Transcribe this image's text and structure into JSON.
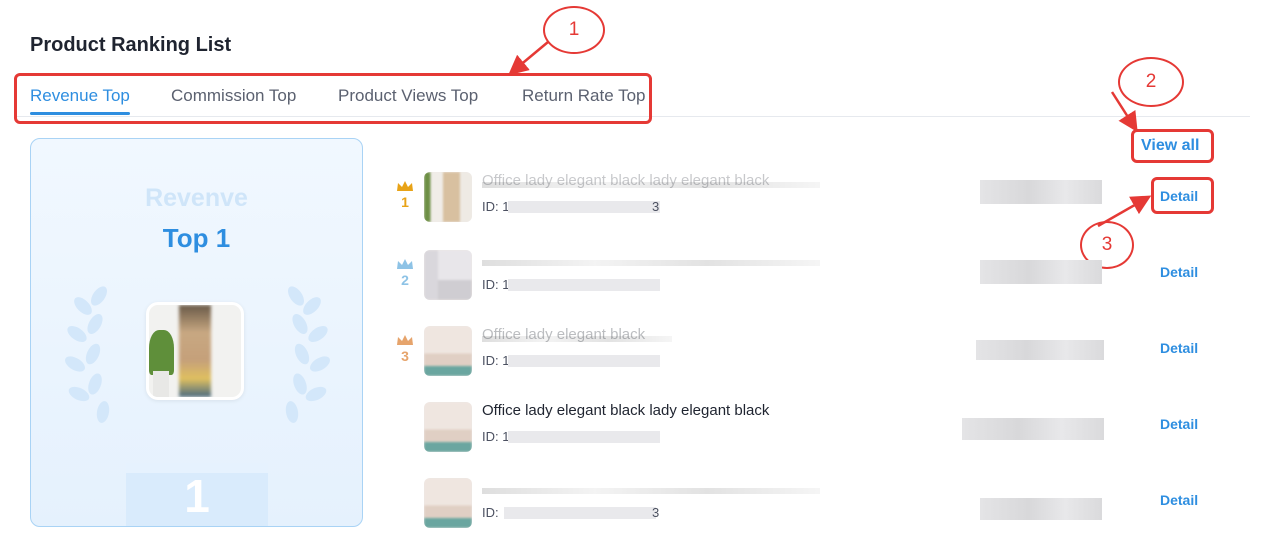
{
  "page": {
    "title": "Product Ranking List"
  },
  "tabs": [
    {
      "label": "Revenue Top",
      "active": true
    },
    {
      "label": "Commission Top",
      "active": false
    },
    {
      "label": "Product Views Top",
      "active": false
    },
    {
      "label": "Return Rate Top",
      "active": false
    }
  ],
  "view_all_label": "View all",
  "top_card": {
    "metric_label": "Revenve",
    "rank_label": "Top 1",
    "podium_number": "1"
  },
  "annotations": [
    "1",
    "2",
    "3"
  ],
  "rows": [
    {
      "rank": "1",
      "name": "Office lady elegant black lady elegant black",
      "id_prefix": "ID: 1",
      "id_suffix": "3",
      "detail_label": "Detail"
    },
    {
      "rank": "2",
      "name": "",
      "id_prefix": "ID: 1",
      "id_suffix": "",
      "detail_label": "Detail"
    },
    {
      "rank": "3",
      "name": "Office lady elegant black",
      "id_prefix": "ID: 1",
      "id_suffix": "",
      "detail_label": "Detail"
    },
    {
      "rank": "",
      "name": "Office lady elegant black lady elegant black",
      "id_prefix": "ID: 1",
      "id_suffix": "",
      "detail_label": "Detail"
    },
    {
      "rank": "",
      "name": "",
      "id_prefix": "ID: ",
      "id_suffix": "3",
      "detail_label": "Detail"
    }
  ],
  "colors": {
    "accent": "#2e8ee0",
    "annotation": "#e53935",
    "gold": "#e8a317",
    "silver": "#8ec3e6",
    "bronze": "#e6a46c"
  }
}
